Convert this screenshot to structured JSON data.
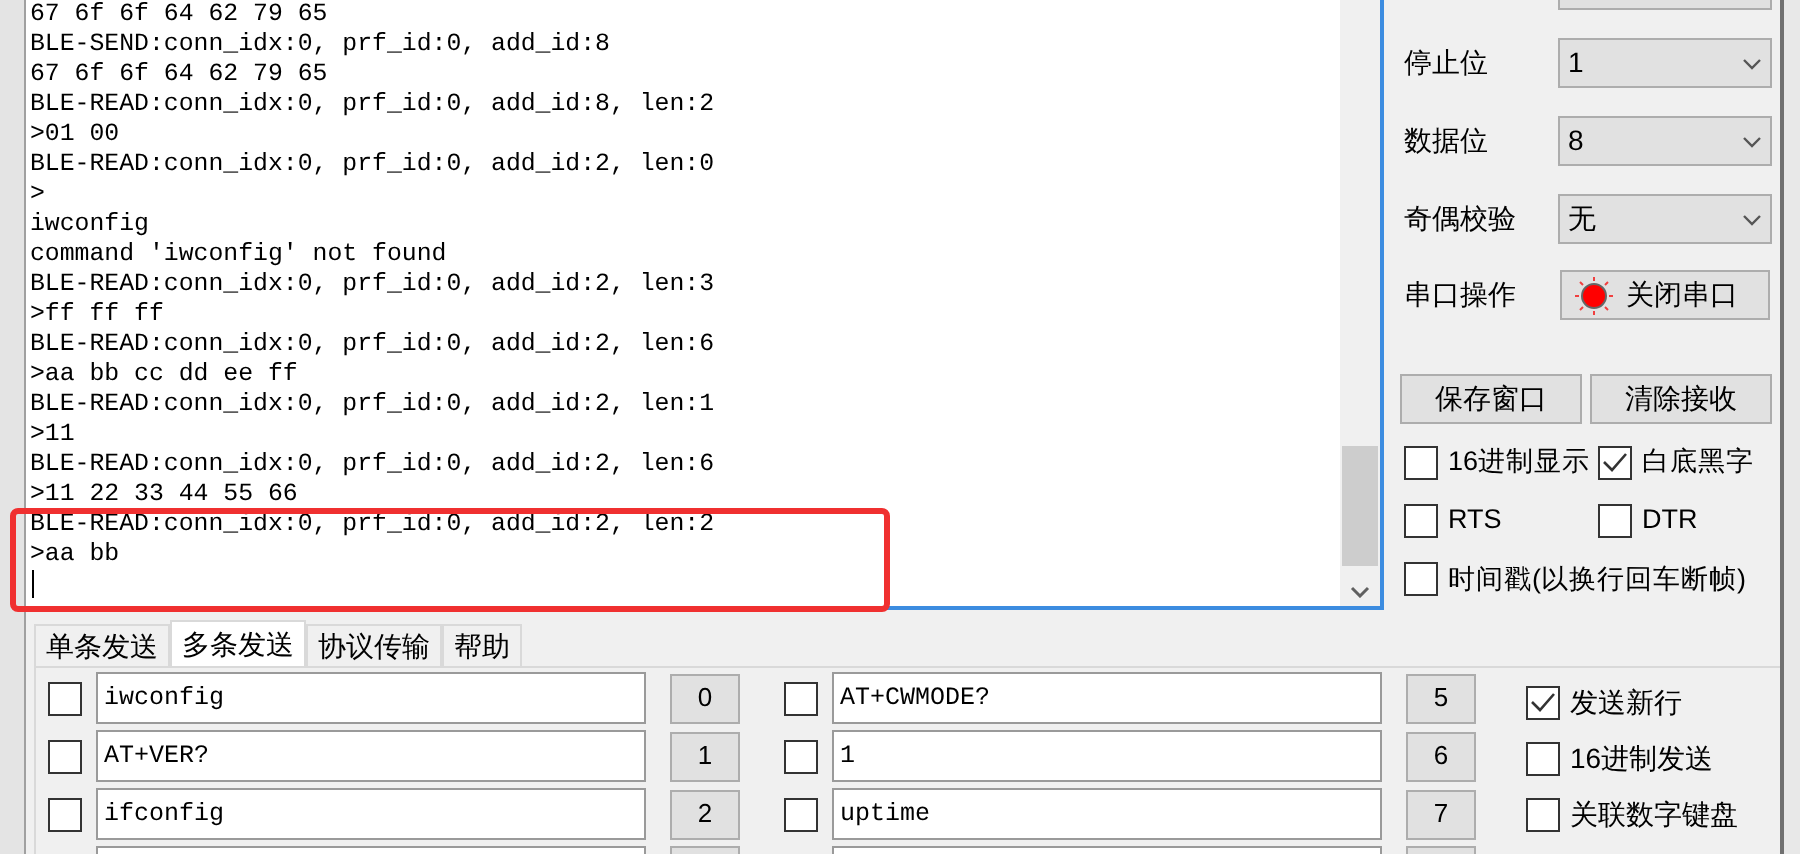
{
  "receive_log": {
    "lines": [
      "67 6f 6f 64 62 79 65",
      "BLE-SEND:conn_idx:0, prf_id:0, add_id:8",
      "67 6f 6f 64 62 79 65",
      "BLE-READ:conn_idx:0, prf_id:0, add_id:8, len:2",
      ">01 00",
      "BLE-READ:conn_idx:0, prf_id:0, add_id:2, len:0",
      ">",
      "iwconfig",
      "command 'iwconfig' not found",
      "BLE-READ:conn_idx:0, prf_id:0, add_id:2, len:3",
      ">ff ff ff",
      "BLE-READ:conn_idx:0, prf_id:0, add_id:2, len:6",
      ">aa bb cc dd ee ff",
      "BLE-READ:conn_idx:0, prf_id:0, add_id:2, len:1",
      ">11",
      "BLE-READ:conn_idx:0, prf_id:0, add_id:2, len:6",
      ">11 22 33 44 55 66",
      "BLE-READ:conn_idx:0, prf_id:0, add_id:2, len:2",
      ">aa bb"
    ]
  },
  "serial_settings": [
    {
      "label": "停止位",
      "value": "1"
    },
    {
      "label": "数据位",
      "value": "8"
    },
    {
      "label": "奇偶校验",
      "value": "无"
    }
  ],
  "port_action": {
    "label": "串口操作",
    "button": "关闭串口",
    "open": true
  },
  "buttons": [
    "保存窗口",
    "清除接收"
  ],
  "receive_options": [
    {
      "label": "16进制显示",
      "checked": false
    },
    {
      "label": "白底黑字",
      "checked": true
    },
    {
      "label": "RTS",
      "checked": false
    },
    {
      "label": "DTR",
      "checked": false
    },
    {
      "label": "时间戳(以换行回车断帧)",
      "checked": false
    }
  ],
  "tabs": [
    {
      "label": "单条发送",
      "selected": false
    },
    {
      "label": "多条发送",
      "selected": true
    },
    {
      "label": "协议传输",
      "selected": false
    },
    {
      "label": "帮助",
      "selected": false
    }
  ],
  "multi_send": {
    "columns": [
      [
        {
          "checked": false,
          "command": "iwconfig",
          "number": "0"
        },
        {
          "checked": false,
          "command": "AT+VER?",
          "number": "1"
        },
        {
          "checked": false,
          "command": "ifconfig",
          "number": "2"
        }
      ],
      [
        {
          "checked": false,
          "command": "AT+CWMODE?",
          "number": "5"
        },
        {
          "checked": false,
          "command": "1",
          "number": "6"
        },
        {
          "checked": false,
          "command": "uptime",
          "number": "7"
        }
      ]
    ]
  },
  "send_options": [
    {
      "label": "发送新行",
      "checked": true
    },
    {
      "label": "16进制发送",
      "checked": false
    },
    {
      "label": "关联数字键盘",
      "checked": false
    }
  ]
}
